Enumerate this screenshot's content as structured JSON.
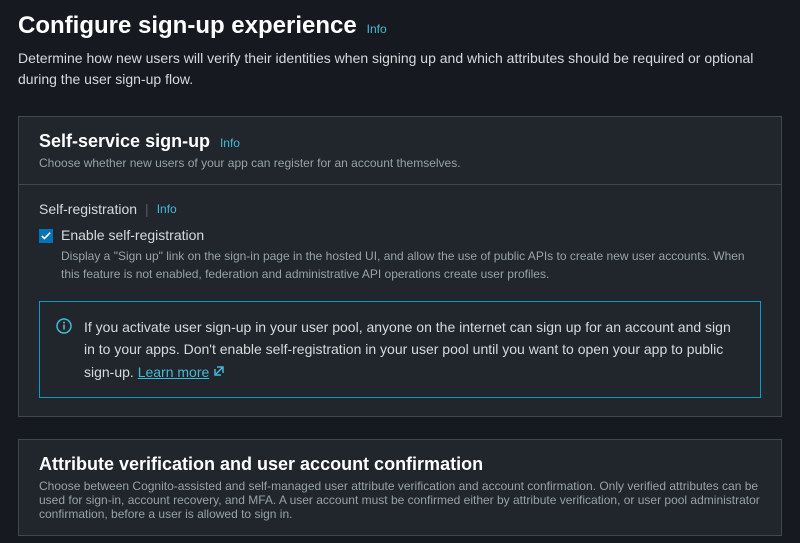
{
  "page": {
    "title": "Configure sign-up experience",
    "info": "Info",
    "subtitle": "Determine how new users will verify their identities when signing up and which attributes should be required or optional during the user sign-up flow."
  },
  "selfService": {
    "title": "Self-service sign-up",
    "info": "Info",
    "desc": "Choose whether new users of your app can register for an account themselves.",
    "fieldLabel": "Self-registration",
    "fieldInfo": "Info",
    "checkboxLabel": "Enable self-registration",
    "checkboxHelp": "Display a \"Sign up\" link on the sign-in page in the hosted UI, and allow the use of public APIs to create new user accounts. When this feature is not enabled, federation and administrative API operations create user profiles.",
    "alertText": "If you activate user sign-up in your user pool, anyone on the internet can sign up for an account and sign in to your apps. Don't enable self-registration in your user pool until you want to open your app to public sign-up. ",
    "learnMore": "Learn more"
  },
  "attrVerify": {
    "title": "Attribute verification and user account confirmation",
    "desc": "Choose between Cognito-assisted and self-managed user attribute verification and account confirmation. Only verified attributes can be used for sign-in, account recovery, and MFA. A user account must be confirmed either by attribute verification, or user pool administrator confirmation, before a user is allowed to sign in."
  }
}
